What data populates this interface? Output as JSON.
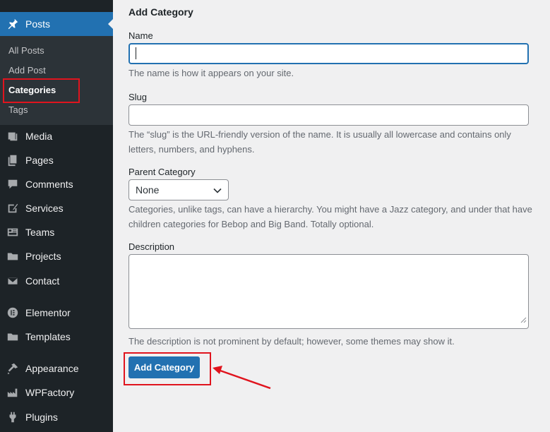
{
  "sidebar": {
    "posts_label": "Posts",
    "submenu": [
      "All Posts",
      "Add Post",
      "Categories",
      "Tags"
    ],
    "items": [
      {
        "label": "Media",
        "icon": "media-icon"
      },
      {
        "label": "Pages",
        "icon": "pages-icon"
      },
      {
        "label": "Comments",
        "icon": "comments-icon"
      },
      {
        "label": "Services",
        "icon": "services-icon"
      },
      {
        "label": "Teams",
        "icon": "teams-icon"
      },
      {
        "label": "Projects",
        "icon": "projects-icon"
      },
      {
        "label": "Contact",
        "icon": "contact-icon"
      },
      {
        "label": "Elementor",
        "icon": "elementor-icon"
      },
      {
        "label": "Templates",
        "icon": "templates-icon"
      },
      {
        "label": "Appearance",
        "icon": "appearance-icon"
      },
      {
        "label": "WPFactory",
        "icon": "wpfactory-icon"
      },
      {
        "label": "Plugins",
        "icon": "plugins-icon"
      }
    ]
  },
  "form": {
    "title": "Add Category",
    "name_label": "Name",
    "name_value": "",
    "name_help": "The name is how it appears on your site.",
    "slug_label": "Slug",
    "slug_value": "",
    "slug_help": "The “slug” is the URL-friendly version of the name. It is usually all lowercase and contains only letters, numbers, and hyphens.",
    "parent_label": "Parent Category",
    "parent_value": "None",
    "parent_help": "Categories, unlike tags, can have a hierarchy. You might have a Jazz category, and under that have children categories for Bebop and Big Band. Totally optional.",
    "description_label": "Description",
    "description_help": "The description is not prominent by default; however, some themes may show it.",
    "submit_label": "Add Category"
  },
  "colors": {
    "accent": "#2271b1",
    "sidebar": "#1d2327",
    "highlight": "#e0141e"
  }
}
